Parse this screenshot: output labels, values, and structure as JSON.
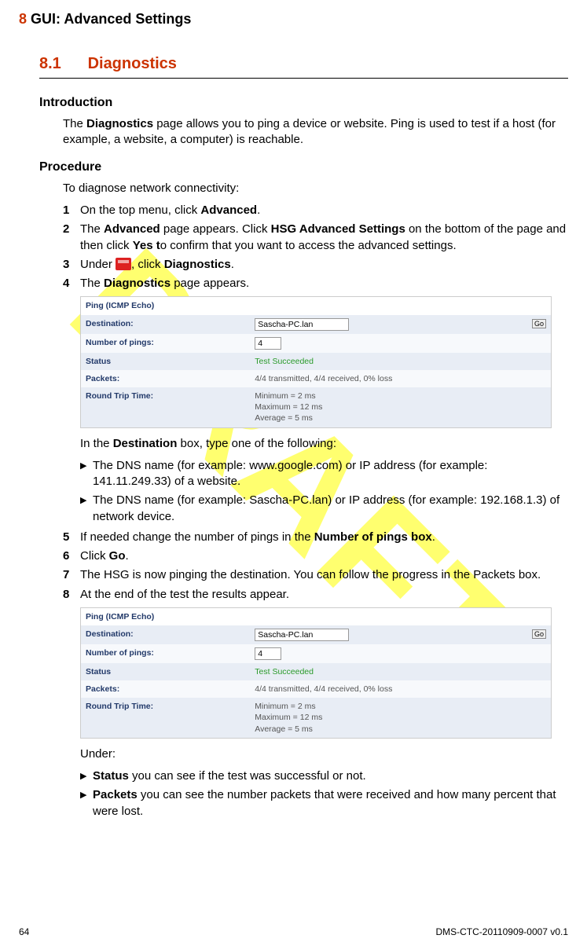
{
  "watermark": "DRAFT",
  "chapter": {
    "num": "8",
    "title": "GUI: Advanced Settings"
  },
  "section": {
    "num": "8.1",
    "title": "Diagnostics"
  },
  "intro": {
    "heading": "Introduction",
    "text_pre": "The ",
    "bold1": "Diagnostics",
    "text_post": " page allows you to ping a device or website. Ping is used to test if a host (for example, a website, a computer) is reachable."
  },
  "procedure": {
    "heading": "Procedure",
    "lead": "To diagnose network connectivity:",
    "s1_a": "On the top menu, click ",
    "s1_b": "Advanced",
    "s1_c": ".",
    "s2_a": "The ",
    "s2_b": "Advanced",
    "s2_c": " page appears. Click ",
    "s2_d": "HSG Advanced Settings",
    "s2_e": " on the bottom of the page and then click ",
    "s2_f": "Yes t",
    "s2_g": "o confirm that you want to access the advanced settings.",
    "s3_a": "Under ",
    "s3_b": ", click ",
    "s3_c": "Diagnostics",
    "s3_d": ".",
    "s4_a": "The ",
    "s4_b": "Diagnostics",
    "s4_c": " page appears.",
    "s4post_a": "In the ",
    "s4post_b": "Destination",
    "s4post_c": " box, type one of the following:",
    "sub1": "The DNS name (for example: www.google.com) or IP address (for example: 141.11.249.33) of a website.",
    "sub2": "The DNS name (for example: Sascha-PC.lan) or IP address (for example: 192.168.1.3) of network device.",
    "s5_a": "If needed change the number of pings in the ",
    "s5_b": "Number of pings box",
    "s5_c": ".",
    "s6_a": "Click ",
    "s6_b": "Go",
    "s6_c": ".",
    "s7": "The HSG is now pinging the destination. You can follow the progress in the Packets box.",
    "s8": "At the end of the test the results appear.",
    "under": "Under:",
    "u1_b": "Status",
    "u1_t": " you can see if the test was successful or not.",
    "u2_b": "Packets",
    "u2_t": " you can see the number packets that were received and how many percent that were lost."
  },
  "shot": {
    "hdr": "Ping (ICMP Echo)",
    "dest_lab": "Destination:",
    "dest_val": "Sascha-PC.lan",
    "go": "Go",
    "pings_lab": "Number of pings:",
    "pings_val": "4",
    "status_lab": "Status",
    "status_val": "Test Succeeded",
    "packets_lab": "Packets:",
    "packets_val": "4/4 transmitted, 4/4 received, 0% loss",
    "rtt_lab": "Round Trip Time:",
    "rtt_min": "Minimum = 2 ms",
    "rtt_max": "Maximum = 12 ms",
    "rtt_avg": "Average = 5 ms"
  },
  "footer": {
    "page": "64",
    "doc": "DMS-CTC-20110909-0007 v0.1"
  }
}
